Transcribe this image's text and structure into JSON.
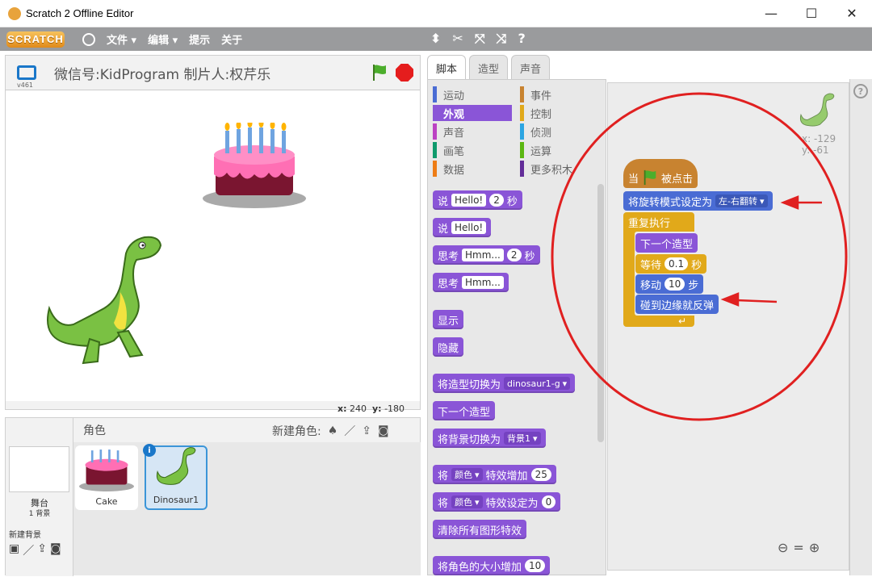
{
  "window": {
    "title": "Scratch 2 Offline Editor",
    "min": "—",
    "max": "☐",
    "close": "✕"
  },
  "menu": {
    "logo": "SCRATCH",
    "file": "文件 ▾",
    "edit": "编辑 ▾",
    "tips": "提示",
    "about": "关于"
  },
  "stage": {
    "title": "微信号:KidProgram 制片人:权芹乐",
    "version": "v461",
    "coords_x_label": "x:",
    "coords_x": "240",
    "coords_y_label": "y:",
    "coords_y": "-180"
  },
  "sprites": {
    "header": "角色",
    "new_sprite": "新建角色:",
    "stage_label": "舞台",
    "stage_sub": "1 背景",
    "new_backdrop": "新建背景",
    "items": [
      {
        "name": "Cake"
      },
      {
        "name": "Dinosaur1"
      }
    ]
  },
  "tabs": [
    "脚本",
    "造型",
    "声音"
  ],
  "categories": [
    {
      "label": "运动",
      "color": "#4a6cd4"
    },
    {
      "label": "外观",
      "color": "#8a55d7"
    },
    {
      "label": "声音",
      "color": "#bb42c3"
    },
    {
      "label": "画笔",
      "color": "#0e9a6c"
    },
    {
      "label": "数据",
      "color": "#ee7d16"
    },
    {
      "label": "事件",
      "color": "#c88330"
    },
    {
      "label": "控制",
      "color": "#e1a91a"
    },
    {
      "label": "侦测",
      "color": "#2ca5e2"
    },
    {
      "label": "运算",
      "color": "#5cb712"
    },
    {
      "label": "更多积木",
      "color": "#632d99"
    }
  ],
  "palette": {
    "say_secs": {
      "a": "说",
      "input": "Hello!",
      "num": "2",
      "b": "秒"
    },
    "say": {
      "a": "说",
      "input": "Hello!"
    },
    "think_secs": {
      "a": "思考",
      "input": "Hmm...",
      "num": "2",
      "b": "秒"
    },
    "think": {
      "a": "思考",
      "input": "Hmm..."
    },
    "show": "显示",
    "hide": "隐藏",
    "switch_costume": {
      "a": "将造型切换为",
      "dd": "dinosaur1-g"
    },
    "next_costume": "下一个造型",
    "switch_backdrop": {
      "a": "将背景切换为",
      "dd": "背景1"
    },
    "change_effect": {
      "a": "将",
      "dd": "颜色",
      "b": "特效增加",
      "num": "25"
    },
    "set_effect": {
      "a": "将",
      "dd": "颜色",
      "b": "特效设定为",
      "num": "0"
    },
    "clear_effects": "清除所有图形特效",
    "change_size": {
      "a": "将角色的大小增加",
      "num": "10"
    }
  },
  "script": {
    "sprite_x": "x: -129",
    "sprite_y": "y: -61",
    "hat": {
      "a": "当",
      "b": "被点击"
    },
    "rotation": {
      "a": "将旋转模式设定为",
      "dd": "左-右翻转"
    },
    "forever": "重复执行",
    "next_costume": "下一个造型",
    "wait": {
      "a": "等待",
      "num": "0.1",
      "b": "秒"
    },
    "move": {
      "a": "移动",
      "num": "10",
      "b": "步"
    },
    "bounce": "碰到边缘就反弹"
  },
  "colors": {
    "annotation": "#e02020"
  }
}
